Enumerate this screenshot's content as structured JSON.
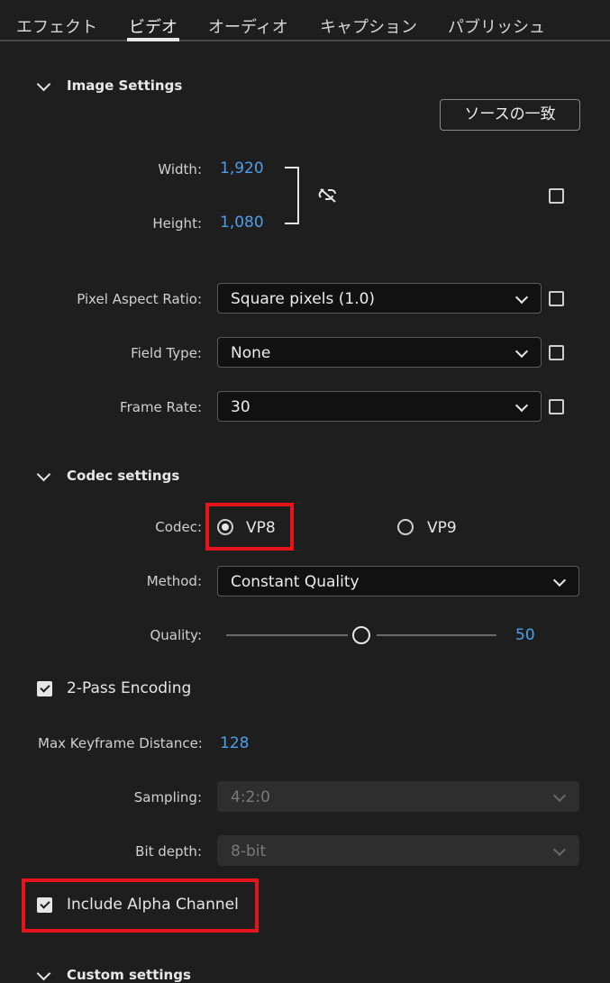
{
  "tabs": [
    {
      "label": "エフェクト"
    },
    {
      "label": "ビデオ",
      "active": true
    },
    {
      "label": "オーディオ"
    },
    {
      "label": "キャプション"
    },
    {
      "label": "パブリッシュ"
    }
  ],
  "image_settings": {
    "title": "Image Settings",
    "match_source_label": "ソースの一致",
    "width_label": "Width:",
    "width_value": "1,920",
    "height_label": "Height:",
    "height_value": "1,080",
    "pixel_aspect_label": "Pixel Aspect Ratio:",
    "pixel_aspect_value": "Square pixels (1.0)",
    "field_type_label": "Field Type:",
    "field_type_value": "None",
    "frame_rate_label": "Frame Rate:",
    "frame_rate_value": "30"
  },
  "codec_settings": {
    "title": "Codec settings",
    "codec_label": "Codec:",
    "codec_options": [
      "VP8",
      "VP9"
    ],
    "codec_selected": "VP8",
    "method_label": "Method:",
    "method_value": "Constant Quality",
    "quality_label": "Quality:",
    "quality_value": "50",
    "two_pass_label": "2-Pass Encoding",
    "two_pass_checked": true,
    "max_keyframe_label": "Max Keyframe Distance:",
    "max_keyframe_value": "128",
    "sampling_label": "Sampling:",
    "sampling_value": "4:2:0",
    "bit_depth_label": "Bit depth:",
    "bit_depth_value": "8-bit",
    "alpha_label": "Include Alpha Channel",
    "alpha_checked": true
  },
  "custom_settings": {
    "title": "Custom settings"
  },
  "colors": {
    "background": "#1e1e1e",
    "accent_blue": "#4d9fe8",
    "highlight_red": "#e8141c"
  },
  "icons": [
    "chevron-down-icon",
    "unlink-icon",
    "checkbox-icon",
    "radio-icon"
  ]
}
